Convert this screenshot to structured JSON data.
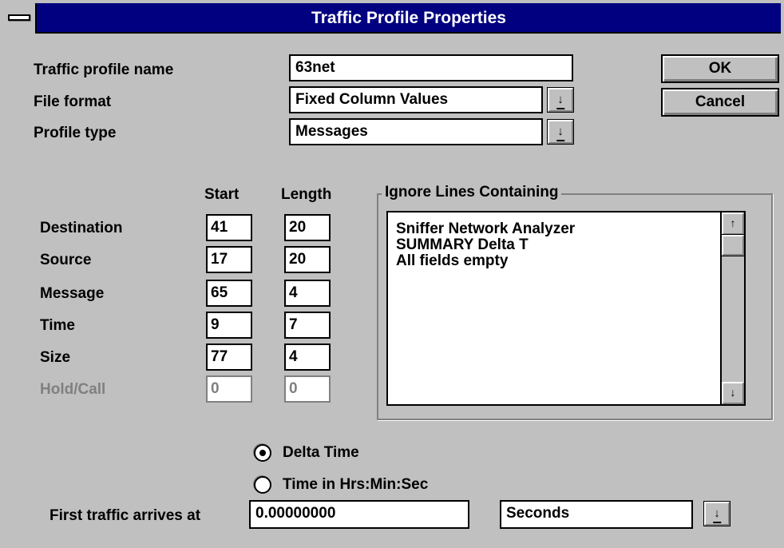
{
  "window": {
    "title": "Traffic Profile Properties"
  },
  "buttons": {
    "ok": "OK",
    "cancel": "Cancel"
  },
  "profile": {
    "name_label": "Traffic profile name",
    "name_value": "63net",
    "format_label": "File format",
    "format_value": "Fixed Column Values",
    "type_label": "Profile type",
    "type_value": "Messages"
  },
  "columns": {
    "start_header": "Start",
    "length_header": "Length",
    "rows": [
      {
        "label": "Destination",
        "start": "41",
        "length": "20",
        "enabled": true
      },
      {
        "label": "Source",
        "start": "17",
        "length": "20",
        "enabled": true
      },
      {
        "label": "Message",
        "start": "65",
        "length": "4",
        "enabled": true
      },
      {
        "label": "Time",
        "start": "9",
        "length": "7",
        "enabled": true
      },
      {
        "label": "Size",
        "start": "77",
        "length": "4",
        "enabled": true
      },
      {
        "label": "Hold/Call",
        "start": "0",
        "length": "0",
        "enabled": false
      }
    ]
  },
  "ignore": {
    "group_label": "Ignore Lines Containing",
    "lines": [
      "Sniffer Network Analyzer",
      "SUMMARY  Delta T",
      "All fields empty"
    ]
  },
  "time_mode": {
    "options": [
      "Delta Time",
      "Time in Hrs:Min:Sec"
    ],
    "selected": "Delta Time"
  },
  "first_traffic": {
    "label": "First traffic arrives at",
    "value": "0.00000000",
    "unit": "Seconds"
  },
  "icons": {
    "system_menu": "system-menu-icon",
    "dropdown": "dropdown-arrow-icon",
    "scroll_up": "scroll-up-arrow-icon",
    "scroll_down": "scroll-down-arrow-icon"
  },
  "colors": {
    "titlebar": "#000080",
    "dialog_face": "#c0c0c0",
    "disabled_text": "#808080"
  }
}
